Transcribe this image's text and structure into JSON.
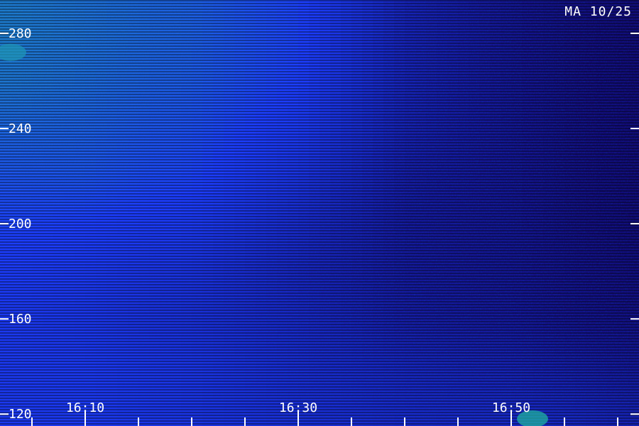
{
  "title": "MA 10/25",
  "colors": {
    "background": "#000000",
    "axis": "#ffffff",
    "intensity_low": "#10005a",
    "intensity_mid": "#1e3cff",
    "intensity_high": "#20ff60"
  },
  "chart_data": {
    "type": "heatmap",
    "title": "MA 10/25",
    "xlabel": "",
    "ylabel": "",
    "x_ticks": [
      "16:10",
      "16:30",
      "16:50"
    ],
    "x_tick_values_min": [
      970,
      990,
      1010
    ],
    "xlim_min": [
      962,
      1022
    ],
    "x_minor_step_min": 5,
    "y_ticks": [
      120,
      160,
      200,
      240,
      280
    ],
    "ylim": [
      115,
      294
    ],
    "grid": false,
    "legend": "none",
    "intensity_profile": {
      "description_axis": "relative signal intensity 0-1",
      "rows_y": [
        120,
        140,
        160,
        180,
        200,
        220,
        240,
        260,
        280
      ],
      "cols_time_min": [
        962,
        970,
        980,
        990,
        1000,
        1010,
        1016,
        1022
      ],
      "values": [
        [
          0.55,
          0.55,
          0.5,
          0.45,
          0.4,
          0.38,
          0.35,
          0.3
        ],
        [
          0.55,
          0.55,
          0.5,
          0.42,
          0.35,
          0.3,
          0.25,
          0.2
        ],
        [
          0.55,
          0.52,
          0.45,
          0.38,
          0.25,
          0.2,
          0.15,
          0.12
        ],
        [
          0.58,
          0.55,
          0.48,
          0.35,
          0.22,
          0.18,
          0.14,
          0.1
        ],
        [
          0.62,
          0.6,
          0.55,
          0.4,
          0.22,
          0.18,
          0.12,
          0.08
        ],
        [
          0.68,
          0.68,
          0.62,
          0.48,
          0.25,
          0.18,
          0.12,
          0.08
        ],
        [
          0.74,
          0.72,
          0.66,
          0.55,
          0.3,
          0.18,
          0.12,
          0.08
        ],
        [
          0.8,
          0.76,
          0.7,
          0.6,
          0.32,
          0.18,
          0.12,
          0.08
        ],
        [
          0.82,
          0.78,
          0.72,
          0.62,
          0.32,
          0.18,
          0.12,
          0.08
        ]
      ]
    },
    "bright_features": [
      {
        "t_min": 1012,
        "y": 118,
        "intensity": 1.0
      },
      {
        "t_min": 963,
        "y": 272,
        "intensity": 0.9
      }
    ]
  }
}
